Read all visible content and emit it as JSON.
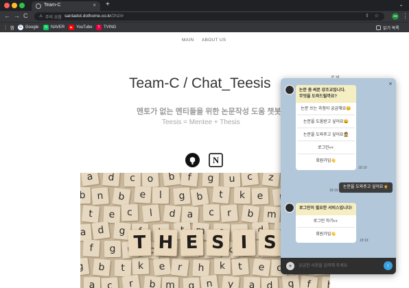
{
  "browser": {
    "tab_title": "Team-C",
    "tab_close": "×",
    "new_tab": "+",
    "tab_chevron": "⌄",
    "nav_back": "←",
    "nav_forward": "→",
    "nav_reload": "C",
    "secure_label": "주의 요함",
    "url_host": "santadot.dothome.co.kr",
    "url_path": "/2h2/#",
    "share_icon": "⇧",
    "star_icon": "☆",
    "extension_badge": "JW",
    "menu_icon": "⋮",
    "bookmarks": [
      {
        "icon": "apps-grid-icon",
        "label": "앱",
        "color": "#e8a33d"
      },
      {
        "icon": "google-icon",
        "label": "Google",
        "color": "#4285f4"
      },
      {
        "icon": "naver-icon",
        "label": "NAVER",
        "color": "#03c75a",
        "glyph": "N"
      },
      {
        "icon": "youtube-icon",
        "label": "YouTube",
        "color": "#ff0000",
        "glyph": "▶"
      },
      {
        "icon": "tving-icon",
        "label": "TVING",
        "color": "#e6003e",
        "glyph": "T"
      }
    ],
    "reading_list": "읽기 목록"
  },
  "page": {
    "nav": [
      "MAIN",
      "ABOUT US"
    ],
    "title": "Team-C / Chat_Teesis",
    "subtitle": "멘토가 없는 멘티들을 위한 논문작성 도움 챗봇",
    "tagline": "Teesis = Mentee + Thesis",
    "icons": [
      "github-icon",
      "notion-icon"
    ],
    "notion_glyph": "N",
    "tiles": {
      "letters": [
        "a",
        "d",
        "c",
        "o",
        "b",
        "f",
        "g",
        "u",
        "c",
        "z",
        "i",
        "h",
        "k",
        "b",
        "n",
        "b",
        "e",
        "l",
        "g",
        "b",
        "t",
        "k",
        "e",
        "r",
        "h",
        "k",
        "t",
        "e",
        "c",
        "l",
        "d",
        "a",
        "c",
        "r",
        "b",
        "m",
        "g",
        "n",
        "y",
        "a",
        "d",
        "g",
        "f",
        "h",
        "t",
        "m",
        "o"
      ],
      "big": [
        "T",
        "H",
        "E",
        "S",
        "I",
        "S"
      ]
    }
  },
  "chat": {
    "close_icon": "×",
    "mini_label": "로 봐",
    "bot_message_1": {
      "header": "논문 좀 써본 강조교입니다.\n무엇을 도와드릴까요?",
      "options": [
        "논문 쓰는 과정이 궁금해요😊",
        "논문을 도움받고 싶어요😀",
        "논문을 도와주고 싶어요🤵",
        "로그인👀",
        "회원가입👋"
      ],
      "time": "18:19"
    },
    "user_message": {
      "text": "논문을 도와주고 싶어요🤵",
      "time": "18:19"
    },
    "bot_message_2": {
      "header": "로그인이 필요한 서비스입니다!",
      "options": [
        "로그인 하기👀",
        "회원가입👋"
      ],
      "time": "18:19"
    },
    "input_placeholder": "궁금한 사항을 입력해 주세요",
    "plus_label": "+",
    "send_label": "↑"
  }
}
